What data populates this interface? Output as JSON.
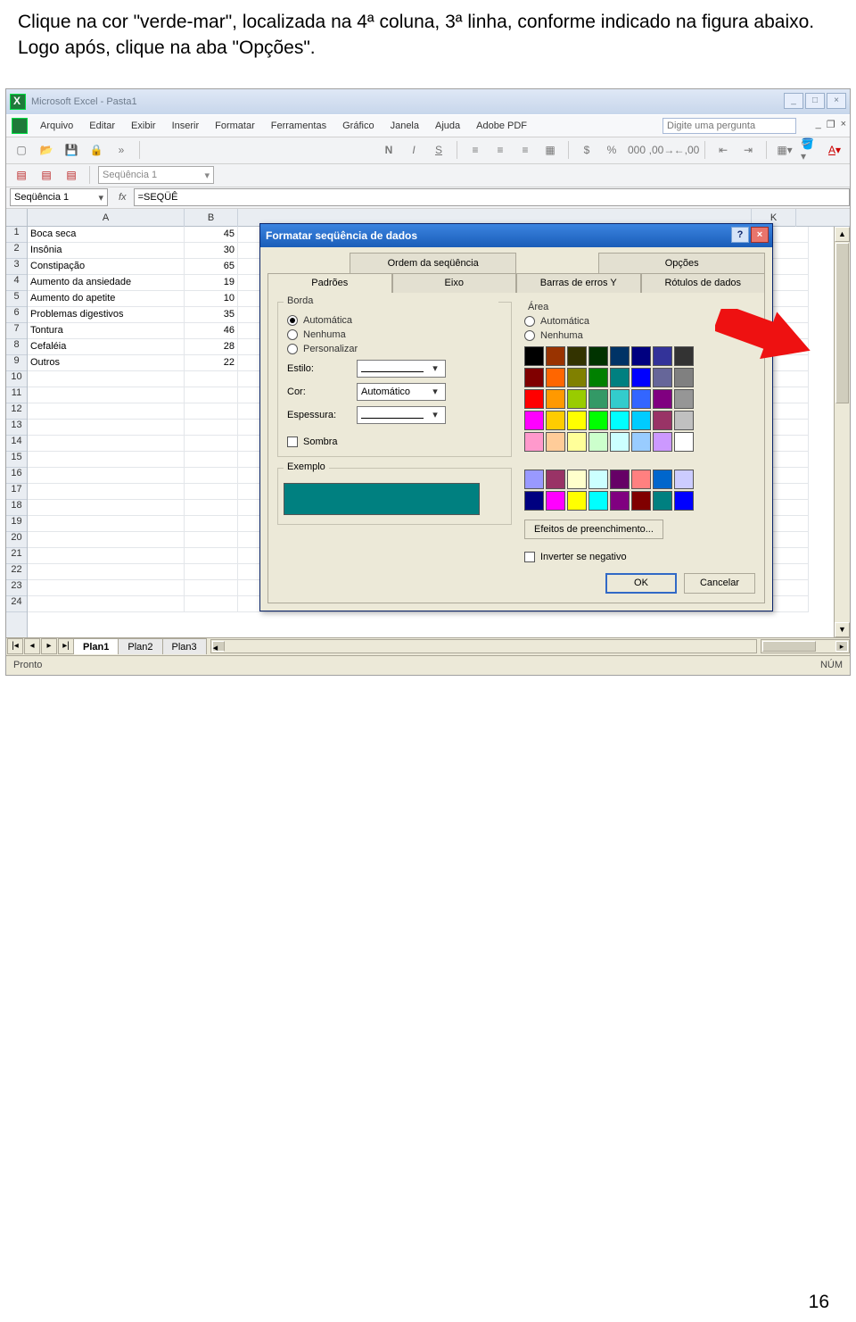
{
  "instruction": "Clique na cor \"verde-mar\", localizada na 4ª coluna, 3ª linha, conforme indicado na figura abaixo. Logo após, clique na aba \"Opções\".",
  "page_number": "16",
  "excel": {
    "title": "Microsoft Excel - Pasta1",
    "menus": [
      "Arquivo",
      "Editar",
      "Exibir",
      "Inserir",
      "Formatar",
      "Ferramentas",
      "Gráfico",
      "Janela",
      "Ajuda",
      "Adobe PDF"
    ],
    "ask_placeholder": "Digite uma pergunta",
    "name_box": "Seqüência 1",
    "formula": "=SEQÜÊ",
    "dropdown_text": "Seqüência 1",
    "columns": [
      "A",
      "B",
      "K"
    ],
    "rows": [
      {
        "n": "1",
        "a": "Boca seca",
        "b": "45"
      },
      {
        "n": "2",
        "a": "Insônia",
        "b": "30"
      },
      {
        "n": "3",
        "a": "Constipação",
        "b": "65"
      },
      {
        "n": "4",
        "a": "Aumento da ansiedade",
        "b": "19"
      },
      {
        "n": "5",
        "a": "Aumento do apetite",
        "b": "10"
      },
      {
        "n": "6",
        "a": "Problemas digestivos",
        "b": "35"
      },
      {
        "n": "7",
        "a": "Tontura",
        "b": "46"
      },
      {
        "n": "8",
        "a": "Cefaléia",
        "b": "28"
      },
      {
        "n": "9",
        "a": "Outros",
        "b": "22"
      }
    ],
    "extra_rows": [
      "10",
      "11",
      "12",
      "13",
      "14",
      "15",
      "16",
      "17",
      "18",
      "19",
      "20",
      "21",
      "22",
      "23",
      "24"
    ],
    "sheet_tabs": [
      "Plan1",
      "Plan2",
      "Plan3"
    ],
    "status_left": "Pronto",
    "status_right": "NÚM"
  },
  "dialog": {
    "title": "Formatar seqüência de dados",
    "tabs_top": [
      "Ordem da seqüência",
      "Opções"
    ],
    "tabs_bottom": [
      "Padrões",
      "Eixo",
      "Barras de erros Y",
      "Rótulos de dados"
    ],
    "border_legend": "Borda",
    "border_opts": {
      "auto": "Automática",
      "none": "Nenhuma",
      "custom": "Personalizar"
    },
    "labels": {
      "style": "Estilo:",
      "color": "Cor:",
      "weight": "Espessura:",
      "shadow": "Sombra"
    },
    "color_combo": "Automático",
    "area_legend": "Área",
    "area_opts": {
      "auto": "Automática",
      "none": "Nenhuma"
    },
    "fill_effects": "Efeitos de preenchimento...",
    "invert": "Inverter se negativo",
    "example_legend": "Exemplo",
    "ok": "OK",
    "cancel": "Cancelar",
    "palette1": [
      "#000000",
      "#993300",
      "#333300",
      "#003300",
      "#003366",
      "#000080",
      "#333399",
      "#333333",
      "#800000",
      "#ff6600",
      "#808000",
      "#008000",
      "#008080",
      "#0000ff",
      "#666699",
      "#808080",
      "#ff0000",
      "#ff9900",
      "#99cc00",
      "#339966",
      "#33cccc",
      "#3366ff",
      "#800080",
      "#969696",
      "#ff00ff",
      "#ffcc00",
      "#ffff00",
      "#00ff00",
      "#00ffff",
      "#00ccff",
      "#993366",
      "#c0c0c0",
      "#ff99cc",
      "#ffcc99",
      "#ffff99",
      "#ccffcc",
      "#ccffff",
      "#99ccff",
      "#cc99ff",
      "#ffffff"
    ],
    "palette2": [
      "#9999ff",
      "#993366",
      "#ffffcc",
      "#ccffff",
      "#660066",
      "#ff8080",
      "#0066cc",
      "#ccccff",
      "#000080",
      "#ff00ff",
      "#ffff00",
      "#00ffff",
      "#800080",
      "#800000",
      "#008080",
      "#0000ff"
    ]
  }
}
